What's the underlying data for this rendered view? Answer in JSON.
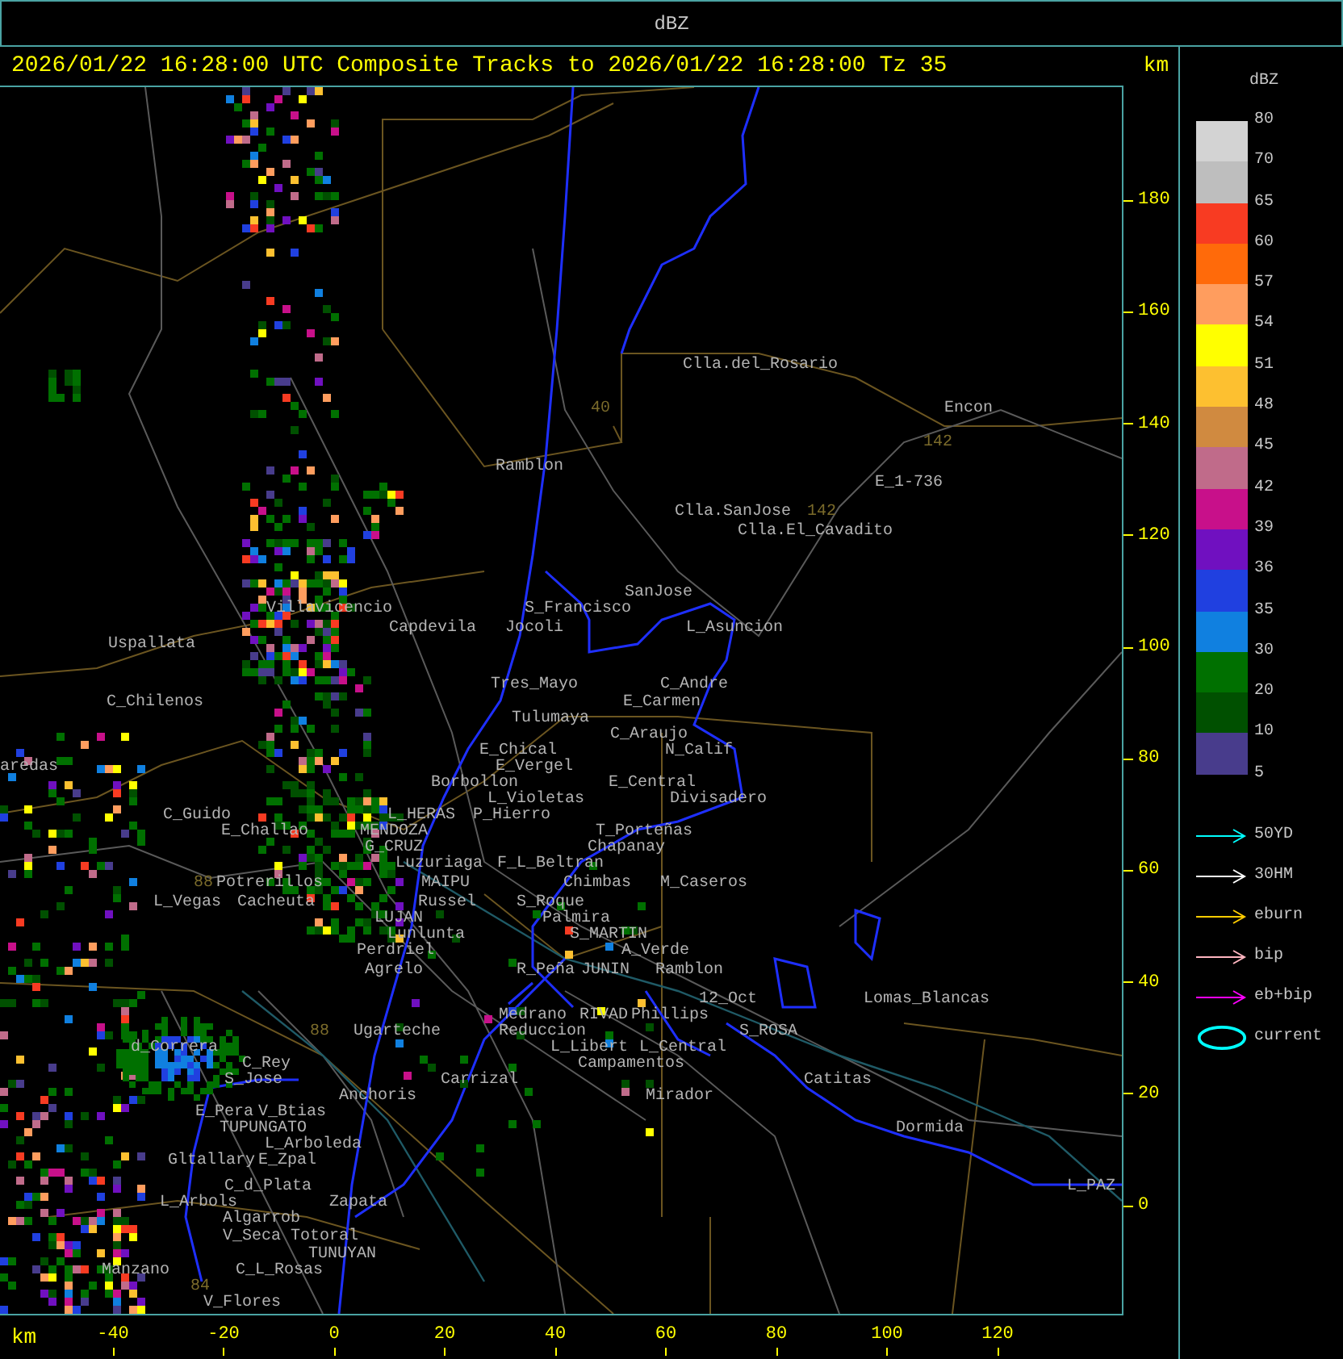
{
  "window": {
    "title": "dBZ"
  },
  "header": {
    "text": "2026/01/22 16:28:00 UTC Composite Tracks to 2026/01/22 16:28:00 Tz 35",
    "unit": "km"
  },
  "map": {
    "places": [
      {
        "name": "Clla.del_Rosario",
        "kind": "place"
      },
      {
        "name": "40",
        "kind": "route"
      },
      {
        "name": "Encon",
        "kind": "place"
      },
      {
        "name": "142",
        "kind": "route"
      },
      {
        "name": "Ramblon",
        "kind": "place"
      },
      {
        "name": "E_1-736",
        "kind": "place"
      },
      {
        "name": "Clla.SanJose",
        "kind": "place"
      },
      {
        "name": "142",
        "kind": "route"
      },
      {
        "name": "Clla.El_Cavadito",
        "kind": "place"
      },
      {
        "name": "SanJose",
        "kind": "place"
      },
      {
        "name": "Villavicencio",
        "kind": "place"
      },
      {
        "name": "S_Francisco",
        "kind": "place"
      },
      {
        "name": "Capdevila",
        "kind": "place"
      },
      {
        "name": "Jocoli",
        "kind": "place"
      },
      {
        "name": "L_Asuncion",
        "kind": "place"
      },
      {
        "name": "Uspallata",
        "kind": "place"
      },
      {
        "name": "Tres_Mayo",
        "kind": "place"
      },
      {
        "name": "C_Andre",
        "kind": "place"
      },
      {
        "name": "C_Chilenos",
        "kind": "place"
      },
      {
        "name": "E_Carmen",
        "kind": "place"
      },
      {
        "name": "Tulumaya",
        "kind": "place"
      },
      {
        "name": "C_Araujo",
        "kind": "place"
      },
      {
        "name": "E_Chical",
        "kind": "place"
      },
      {
        "name": "N_Calif",
        "kind": "place"
      },
      {
        "name": "aredas",
        "kind": "place"
      },
      {
        "name": "E_Vergel",
        "kind": "place"
      },
      {
        "name": "Borbollon",
        "kind": "place"
      },
      {
        "name": "E_Central",
        "kind": "place"
      },
      {
        "name": "L_Violetas",
        "kind": "place"
      },
      {
        "name": "Divisadero",
        "kind": "place"
      },
      {
        "name": "C_Guido",
        "kind": "place"
      },
      {
        "name": "L_HERAS",
        "kind": "place"
      },
      {
        "name": "P_Hierro",
        "kind": "place"
      },
      {
        "name": "E_Challao",
        "kind": "place"
      },
      {
        "name": "MENDOZA",
        "kind": "place"
      },
      {
        "name": "T_Porteñas",
        "kind": "place"
      },
      {
        "name": "G_CRUZ",
        "kind": "place"
      },
      {
        "name": "Chapanay",
        "kind": "place"
      },
      {
        "name": "Luzuriaga",
        "kind": "place"
      },
      {
        "name": "F_L_Beltran",
        "kind": "place"
      },
      {
        "name": "88",
        "kind": "route"
      },
      {
        "name": "Potrerillos",
        "kind": "place"
      },
      {
        "name": "MAIPU",
        "kind": "place"
      },
      {
        "name": "Chimbas",
        "kind": "place"
      },
      {
        "name": "M_Caseros",
        "kind": "place"
      },
      {
        "name": "L_Vegas",
        "kind": "place"
      },
      {
        "name": "Cacheuta",
        "kind": "place"
      },
      {
        "name": "Russel",
        "kind": "place"
      },
      {
        "name": "S_Roque",
        "kind": "place"
      },
      {
        "name": "LUJAN",
        "kind": "place"
      },
      {
        "name": "Palmira",
        "kind": "place"
      },
      {
        "name": "Lunlunta",
        "kind": "place"
      },
      {
        "name": "S_MARTIN",
        "kind": "place"
      },
      {
        "name": "Perdriel",
        "kind": "place"
      },
      {
        "name": "A_Verde",
        "kind": "place"
      },
      {
        "name": "Agrelo",
        "kind": "place"
      },
      {
        "name": "R_Peña",
        "kind": "place"
      },
      {
        "name": "JUNIN",
        "kind": "place"
      },
      {
        "name": "Ramblon",
        "kind": "place"
      },
      {
        "name": "12_Oct",
        "kind": "place"
      },
      {
        "name": "Lomas_Blancas",
        "kind": "place"
      },
      {
        "name": "Medrano",
        "kind": "place"
      },
      {
        "name": "RIVAD",
        "kind": "place"
      },
      {
        "name": "Phillips",
        "kind": "place"
      },
      {
        "name": "88",
        "kind": "route"
      },
      {
        "name": "Ugarteche",
        "kind": "place"
      },
      {
        "name": "Reduccion",
        "kind": "place"
      },
      {
        "name": "S_ROSA",
        "kind": "place"
      },
      {
        "name": "d_Correra",
        "kind": "place"
      },
      {
        "name": "L_Libert",
        "kind": "place"
      },
      {
        "name": "L_Central",
        "kind": "place"
      },
      {
        "name": "C_Rey",
        "kind": "place"
      },
      {
        "name": "Campamentos",
        "kind": "place"
      },
      {
        "name": "S_Jose",
        "kind": "place"
      },
      {
        "name": "Carrizal",
        "kind": "place"
      },
      {
        "name": "Catitas",
        "kind": "place"
      },
      {
        "name": "Anchoris",
        "kind": "place"
      },
      {
        "name": "Mirador",
        "kind": "place"
      },
      {
        "name": "E_Pera",
        "kind": "place"
      },
      {
        "name": "V_Btias",
        "kind": "place"
      },
      {
        "name": "TUPUNGATO",
        "kind": "place"
      },
      {
        "name": "Dormida",
        "kind": "place"
      },
      {
        "name": "L_Arboleda",
        "kind": "place"
      },
      {
        "name": "Gltallary",
        "kind": "place"
      },
      {
        "name": "E_Zpal",
        "kind": "place"
      },
      {
        "name": "C_d_Plata",
        "kind": "place"
      },
      {
        "name": "L_PAZ",
        "kind": "place"
      },
      {
        "name": "L_Arbols",
        "kind": "place"
      },
      {
        "name": "Zapata",
        "kind": "place"
      },
      {
        "name": "Algarrob",
        "kind": "place"
      },
      {
        "name": "V_Seca",
        "kind": "place"
      },
      {
        "name": "Totoral",
        "kind": "place"
      },
      {
        "name": "TUNUYAN",
        "kind": "place"
      },
      {
        "name": "Manzano",
        "kind": "place"
      },
      {
        "name": "C_L_Rosas",
        "kind": "place"
      },
      {
        "name": "84",
        "kind": "route"
      },
      {
        "name": "V_Flores",
        "kind": "place"
      }
    ]
  },
  "y_axis": {
    "ticks": [
      "180",
      "160",
      "140",
      "120",
      "100",
      "80",
      "60",
      "40",
      "20",
      "0"
    ]
  },
  "x_axis": {
    "unit": "km",
    "ticks": [
      "-40",
      "-20",
      "0",
      "20",
      "40",
      "60",
      "80",
      "100",
      "120"
    ]
  },
  "legend": {
    "title": "dBZ",
    "levels": [
      "80",
      "70",
      "65",
      "60",
      "57",
      "54",
      "51",
      "48",
      "45",
      "42",
      "39",
      "36",
      "35",
      "30",
      "20",
      "10",
      "5"
    ],
    "bins": [
      {
        "color": "#d3d3d3"
      },
      {
        "color": "#bebebe"
      },
      {
        "color": "#f83b22"
      },
      {
        "color": "#ff6a0a"
      },
      {
        "color": "#ff9d5e"
      },
      {
        "color": "#ffff00"
      },
      {
        "color": "#fdc030"
      },
      {
        "color": "#d08a40"
      },
      {
        "color": "#c06b8a"
      },
      {
        "color": "#c8108a"
      },
      {
        "color": "#7010c0"
      },
      {
        "color": "#2040e0"
      },
      {
        "color": "#1080e0"
      },
      {
        "color": "#007000"
      },
      {
        "color": "#005000"
      },
      {
        "color": "#483c8c"
      }
    ],
    "tracks": [
      {
        "label": "50YD",
        "kind": "arrow",
        "color": "#00ffff"
      },
      {
        "label": "30HM",
        "kind": "arrow",
        "color": "#ffffff"
      },
      {
        "label": "eburn",
        "kind": "arrow",
        "color": "#ffcc00"
      },
      {
        "label": "bip",
        "kind": "arrow",
        "color": "#ffb6c1"
      },
      {
        "label": "eb+bip",
        "kind": "arrow",
        "color": "#ff00ff"
      },
      {
        "label": "current",
        "kind": "ellipse",
        "color": "#00ffff"
      }
    ]
  }
}
